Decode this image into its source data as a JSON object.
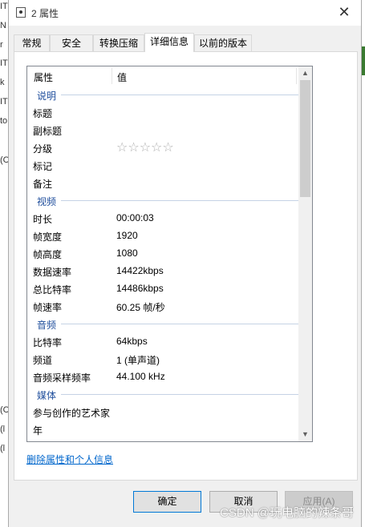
{
  "window": {
    "title": "2 属性",
    "close_glyph": "✕"
  },
  "tabs": [
    {
      "label": "常规"
    },
    {
      "label": "安全"
    },
    {
      "label": "转换压缩"
    },
    {
      "label": "详细信息"
    },
    {
      "label": "以前的版本"
    }
  ],
  "details": {
    "col_property": "属性",
    "col_value": "值",
    "groups": {
      "description": "说明",
      "video": "视频",
      "audio": "音频",
      "media": "媒体"
    },
    "rows": {
      "title": {
        "k": "标题",
        "v": ""
      },
      "subtitle": {
        "k": "副标题",
        "v": ""
      },
      "rating": {
        "k": "分级",
        "v": "☆☆☆☆☆"
      },
      "tags": {
        "k": "标记",
        "v": ""
      },
      "comments": {
        "k": "备注",
        "v": ""
      },
      "length": {
        "k": "时长",
        "v": "00:00:03"
      },
      "frame_width": {
        "k": "帧宽度",
        "v": "1920"
      },
      "frame_height": {
        "k": "帧高度",
        "v": "1080"
      },
      "data_rate": {
        "k": "数据速率",
        "v": "14422kbps"
      },
      "total_bitrate": {
        "k": "总比特率",
        "v": "14486kbps"
      },
      "frame_rate": {
        "k": "帧速率",
        "v": "60.25 帧/秒"
      },
      "bitrate": {
        "k": "比特率",
        "v": "64kbps"
      },
      "channels": {
        "k": "频道",
        "v": "1 (单声道)"
      },
      "sample_rate": {
        "k": "音频采样频率",
        "v": "44.100 kHz"
      },
      "contributing_artists": {
        "k": "参与创作的艺术家",
        "v": ""
      },
      "year": {
        "k": "年",
        "v": ""
      }
    }
  },
  "remove_link": "删除属性和个人信息",
  "buttons": {
    "ok": "确定",
    "cancel": "取消",
    "apply": "应用(A)"
  },
  "watermark": "CSDN @玩电脑的辣条哥",
  "background_strip": [
    "IT",
    "N",
    "r",
    "IT",
    "k",
    "IT",
    "to",
    "(C",
    "(C",
    "(l",
    "(l"
  ]
}
